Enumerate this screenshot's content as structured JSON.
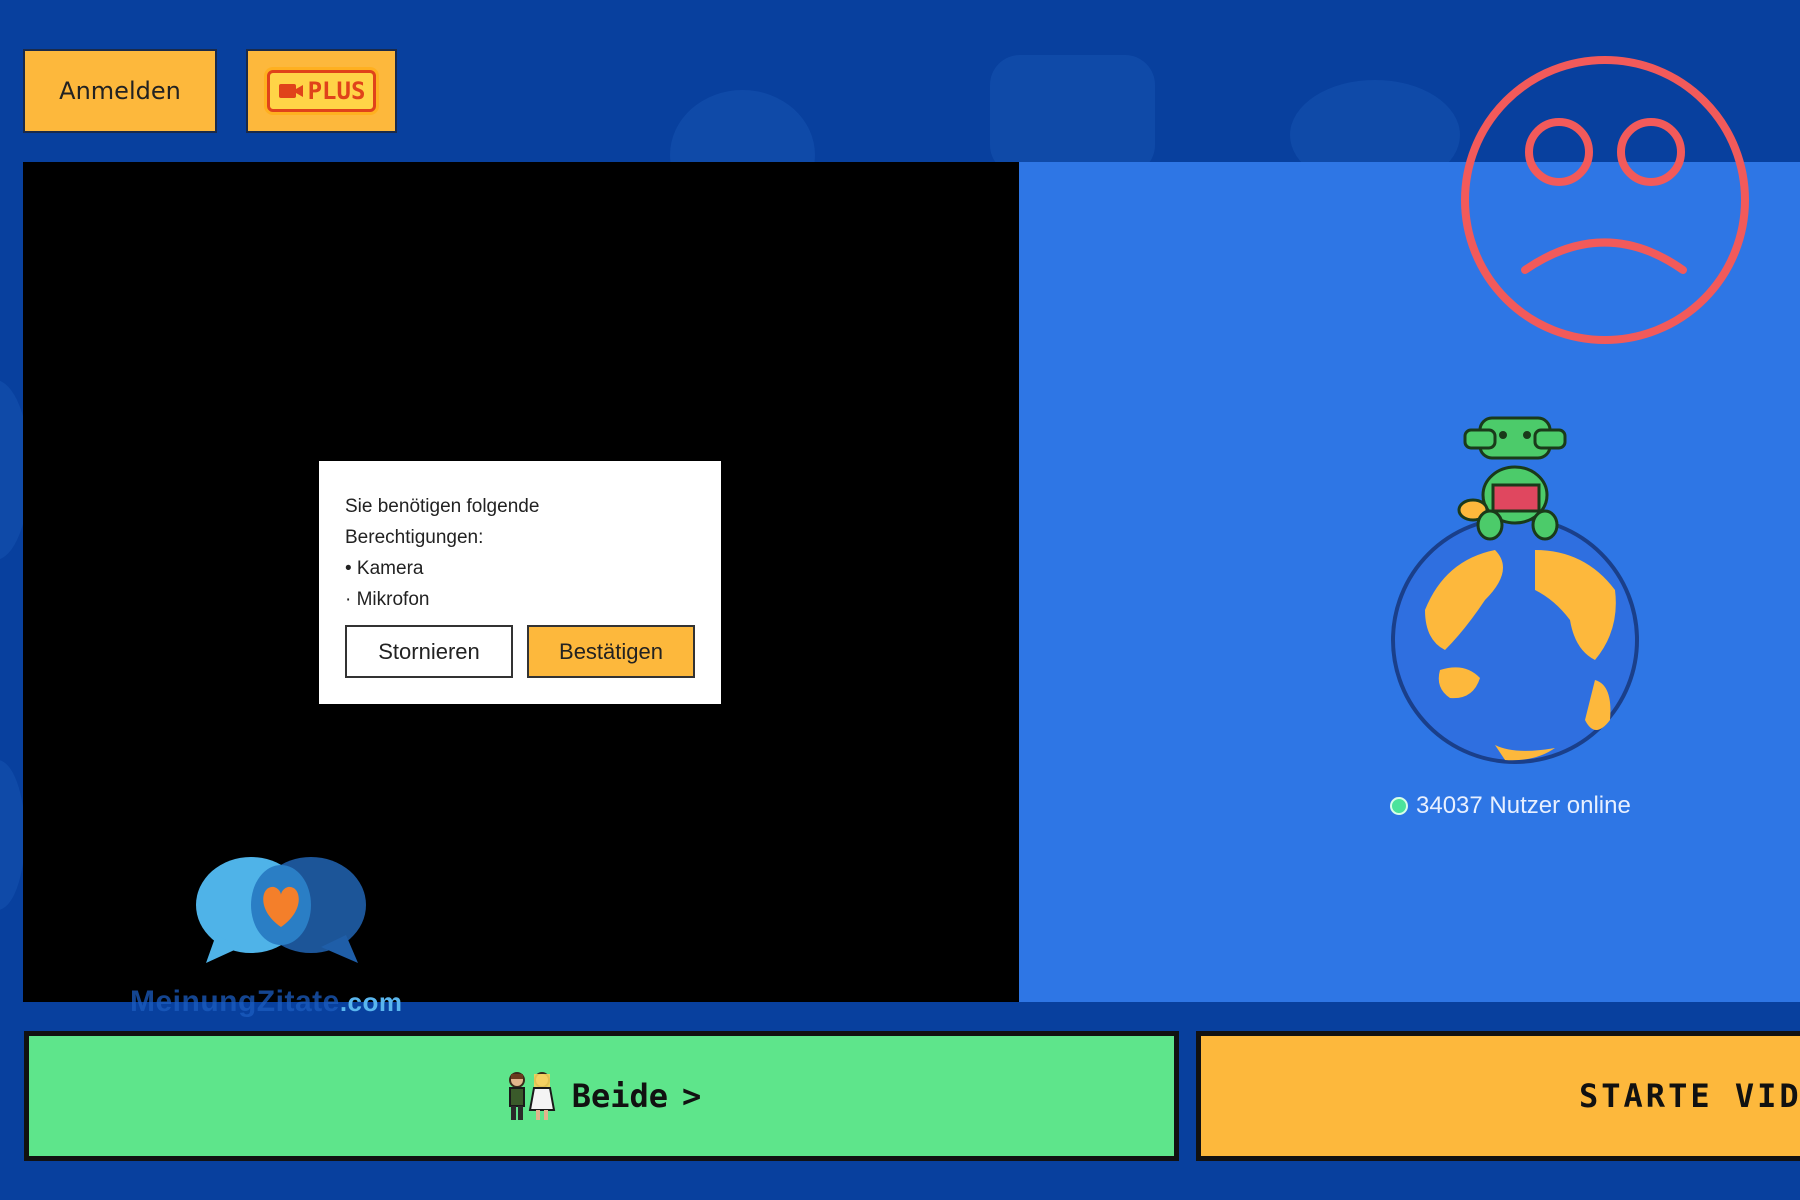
{
  "header": {
    "login_label": "Anmelden",
    "plus_label": "PLUS"
  },
  "dialog": {
    "line1": "Sie benötigen folgende",
    "line2": "Berechtigungen:",
    "permission_camera": "• Kamera",
    "permission_mic": "· Mikrofon",
    "cancel_label": "Stornieren",
    "confirm_label": "Bestätigen"
  },
  "watermark": {
    "brand": "MeinungZitate",
    "domain": ".com"
  },
  "partner": {
    "online_text": "34037 Nutzer online"
  },
  "bottom": {
    "gender_label": "Beide",
    "gender_chevron": ">",
    "start_label": "STARTE VIDE"
  },
  "colors": {
    "background": "#08409e",
    "accent": "#fdb83c",
    "partner_bg": "#2e76e5",
    "gender_button": "#5ee58b",
    "sad_face": "#f25a5a"
  },
  "icons": [
    "plus-camera-icon",
    "sad-face-icon",
    "crocodile-globe-icon",
    "chat-heart-logo-icon",
    "couple-icon",
    "online-dot-icon"
  ]
}
